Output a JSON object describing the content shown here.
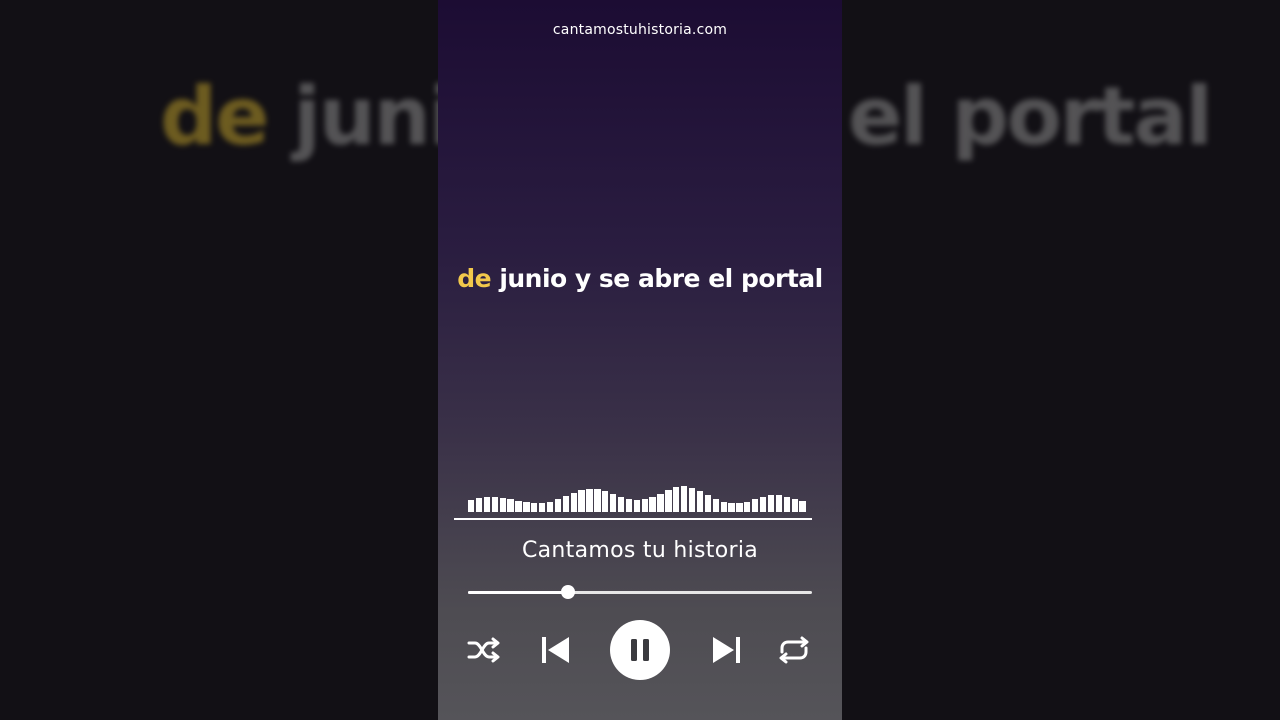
{
  "background": {
    "left_highlight": "de",
    "left_rest": "junio",
    "right_text": "el portal"
  },
  "site": {
    "url": "cantamostuhistoria.com"
  },
  "lyrics": {
    "highlighted": "de",
    "rest": "junio y se abre el portal",
    "highlight_color": "#f2c84b"
  },
  "visualizer": {
    "levels": [
      0.38,
      0.44,
      0.48,
      0.48,
      0.44,
      0.4,
      0.34,
      0.3,
      0.28,
      0.28,
      0.32,
      0.4,
      0.5,
      0.6,
      0.68,
      0.72,
      0.72,
      0.66,
      0.56,
      0.46,
      0.4,
      0.38,
      0.4,
      0.46,
      0.56,
      0.68,
      0.78,
      0.8,
      0.76,
      0.66,
      0.52,
      0.4,
      0.32,
      0.28,
      0.28,
      0.32,
      0.4,
      0.48,
      0.54,
      0.54,
      0.48,
      0.4,
      0.34
    ]
  },
  "player": {
    "track_title": "Cantamos tu historia",
    "progress": 0.29,
    "state": "playing"
  },
  "controls": {
    "shuffle_icon": "shuffle-icon",
    "previous_icon": "skip-previous-icon",
    "pause_icon": "pause-icon",
    "next_icon": "skip-next-icon",
    "repeat_icon": "repeat-icon"
  }
}
